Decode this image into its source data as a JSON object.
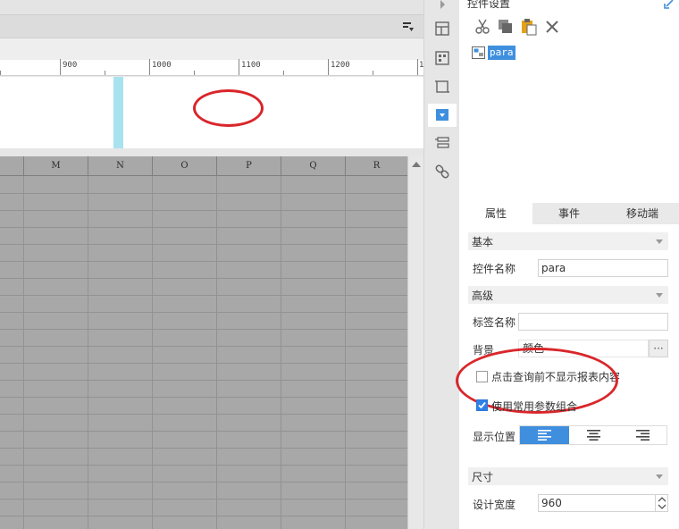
{
  "ruler": {
    "labels": [
      "900",
      "1000",
      "1100",
      "1200",
      "1"
    ]
  },
  "grid": {
    "columns": [
      "M",
      "N",
      "O",
      "P",
      "Q",
      "R"
    ]
  },
  "panel": {
    "title": "控件设置",
    "edit_toolbar": {
      "icons": [
        "cut-icon",
        "copy-icon",
        "paste-icon",
        "delete-icon"
      ]
    },
    "tree": {
      "selected_node": "para"
    },
    "tabs": [
      {
        "label": "属性",
        "active": true
      },
      {
        "label": "事件",
        "active": false
      },
      {
        "label": "移动端",
        "active": false
      }
    ],
    "basic": {
      "section_title": "基本",
      "widget_name_label": "控件名称",
      "widget_name_value": "para"
    },
    "advanced": {
      "section_title": "高级",
      "tag_name_label": "标签名称",
      "tag_name_value": "",
      "background_label": "背景",
      "background_value": "颜色",
      "background_more": "···",
      "hide_before_query_label": "点击查询前不显示报表内容",
      "hide_before_query_checked": false,
      "use_common_params_label": "使用常用参数组合",
      "use_common_params_checked": true,
      "position_label": "显示位置",
      "position_options": [
        "left-align-icon",
        "center-align-icon",
        "right-align-icon"
      ],
      "position_selected": "left-align-icon"
    },
    "size": {
      "section_title": "尺寸",
      "design_width_label": "设计宽度",
      "design_width_value": "960"
    }
  },
  "colors": {
    "accent": "#3f8fde",
    "annotation": "#d9262b",
    "selection_bar": "#a8e2ef",
    "grid_bg": "#a8a8a8"
  }
}
